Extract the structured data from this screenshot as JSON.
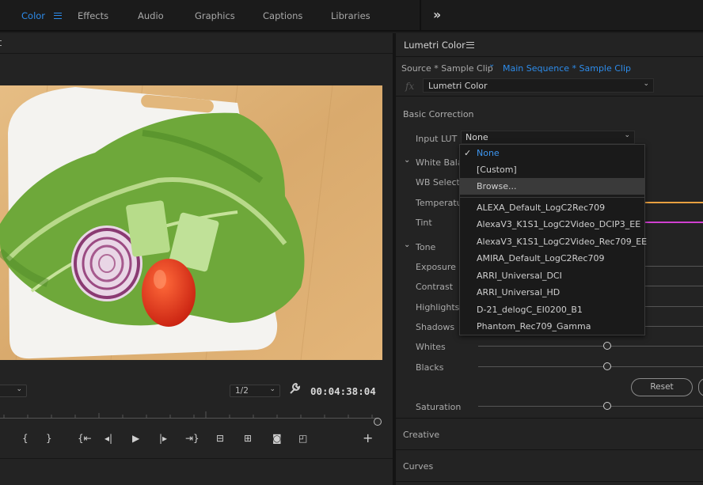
{
  "workspace_tabs": [
    {
      "label": "Color",
      "active": true
    },
    {
      "label": "Effects"
    },
    {
      "label": "Audio"
    },
    {
      "label": "Graphics"
    },
    {
      "label": "Captions"
    },
    {
      "label": "Libraries"
    }
  ],
  "monitor": {
    "resolution": "1/2",
    "timecode": "00:04:38:04"
  },
  "panel": {
    "title": "Lumetri Color",
    "source_clip": "Source * Sample Clip",
    "sequence_clip": "Main Sequence * Sample Clip",
    "fx_symbol": "fx",
    "effect": "Lumetri Color"
  },
  "basic_correction": {
    "title": "Basic Correction",
    "input_lut_label": "Input LUT",
    "input_lut_value": "None",
    "white_balance_label": "White Balance",
    "wb_selector_label": "WB Selector",
    "temperature_label": "Temperature",
    "tint_label": "Tint",
    "tone_label": "Tone",
    "exposure_label": "Exposure",
    "contrast_label": "Contrast",
    "highlights_label": "Highlights",
    "shadows_label": "Shadows",
    "whites_label": "Whites",
    "blacks_label": "Blacks",
    "reset_label": "Reset",
    "saturation_label": "Saturation"
  },
  "sections": {
    "creative": "Creative",
    "curves": "Curves"
  },
  "lut_menu": {
    "items": [
      "None",
      "[Custom]",
      "Browse...",
      "ALEXA_Default_LogC2Rec709",
      "AlexaV3_K1S1_LogC2Video_DCIP3_EE",
      "AlexaV3_K1S1_LogC2Video_Rec709_EE",
      "AMIRA_Default_LogC2Rec709",
      "ARRI_Universal_DCI",
      "ARRI_Universal_HD",
      "D-21_delogC_EI0200_B1",
      "Phantom_Rec709_Gamma"
    ],
    "selected": "None",
    "hovered": "Browse..."
  },
  "colors": {
    "accent": "#2d8ceb",
    "temperature_track": "#e8a040",
    "tint_track": "#d040d0"
  },
  "icons": [
    "workspace-menu-icon",
    "more-workspaces-icon",
    "wrench-icon",
    "panel-menu-icon",
    "chevron-down-icon",
    "checkmark-icon",
    "add-icon"
  ]
}
